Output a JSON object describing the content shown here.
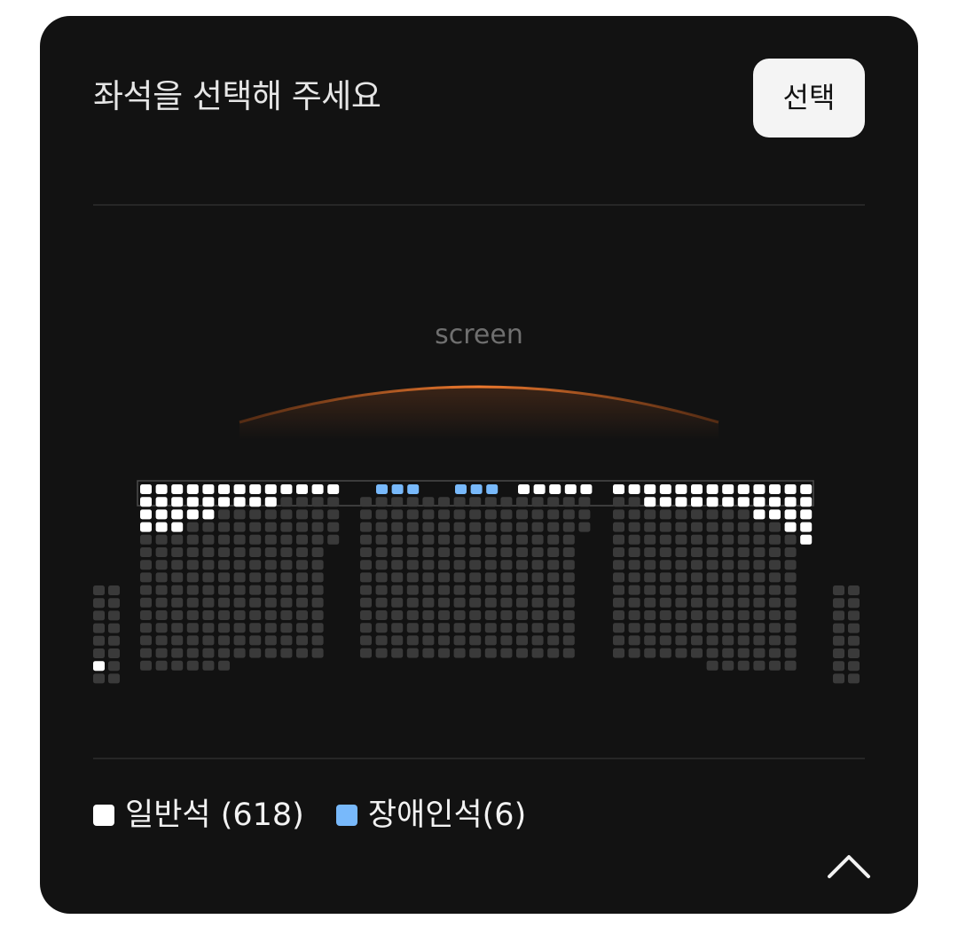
{
  "header": {
    "title": "좌석을 선택해 주세요",
    "select_button_label": "선택"
  },
  "screen": {
    "label": "screen",
    "glow_color": "#e8702a"
  },
  "seat_colors": {
    "available": "#ffffff",
    "accessible": "#78b9fb",
    "unavailable": "#3a3a3a"
  },
  "legend": {
    "items": [
      {
        "label": "일반석 (618)",
        "color": "#ffffff"
      },
      {
        "label": "장애인석(6)",
        "color": "#78b9fb"
      }
    ]
  },
  "footer": {
    "collapse_icon": "chevron-up-icon"
  }
}
